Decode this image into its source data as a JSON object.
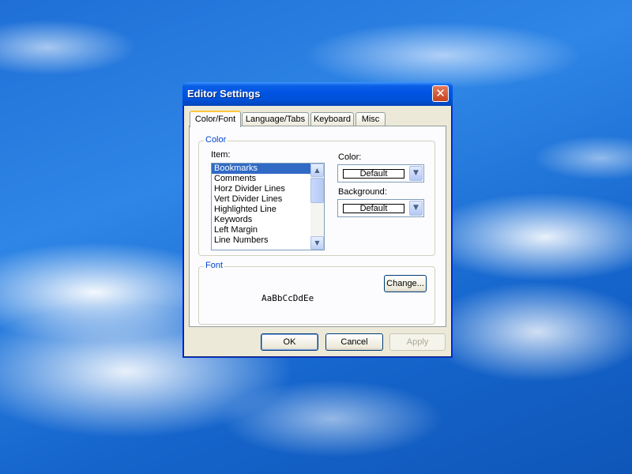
{
  "window": {
    "title": "Editor Settings",
    "close_symbol": "✕"
  },
  "tabs": [
    {
      "label": "Color/Font"
    },
    {
      "label": "Language/Tabs"
    },
    {
      "label": "Keyboard"
    },
    {
      "label": "Misc"
    }
  ],
  "color_group": {
    "title": "Color",
    "item_label": "Item:",
    "items": [
      "Bookmarks",
      "Comments",
      "Horz Divider Lines",
      "Vert Divider Lines",
      "Highlighted Line",
      "Keywords",
      "Left Margin",
      "Line Numbers"
    ],
    "selected_item": "Bookmarks",
    "color_label": "Color:",
    "color_value": "Default",
    "background_label": "Background:",
    "background_value": "Default"
  },
  "font_group": {
    "title": "Font",
    "change_button": "Change...",
    "sample_text": "AaBbCcDdEe"
  },
  "buttons": {
    "ok": "OK",
    "cancel": "Cancel",
    "apply": "Apply"
  },
  "colors": {
    "title_bar": "#0054e3",
    "selection": "#316ac5",
    "group_title": "#0046d5",
    "dialog_face": "#ece9d8"
  }
}
